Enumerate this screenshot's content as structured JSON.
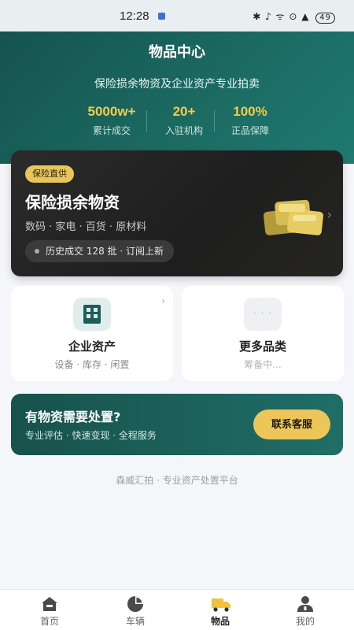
{
  "status_bar": {
    "time": "12:28",
    "indicators": "✱ ♪ ᯤ ⊙ ▲",
    "battery": "49"
  },
  "hero": {
    "title": "物品中心",
    "subtitle": "保险损余物资及企业资产专业拍卖",
    "stats": [
      {
        "value": "5000w+",
        "label": "累计成交"
      },
      {
        "value": "20+",
        "label": "入驻机构"
      },
      {
        "value": "100%",
        "label": "正品保障"
      }
    ],
    "accent_color": "#f2cc4d"
  },
  "insurance_card": {
    "badge": "保险直供",
    "title": "保险损余物资",
    "categories": "数码 · 家电 · 百货 · 原材料",
    "pill_text": "历史成交 128 批 · 订阅上新",
    "icon": "gold-bars-icon",
    "chevron": "›"
  },
  "tiles": [
    {
      "title": "企业资产",
      "subtitle": "设备 · 库存 · 闲置",
      "icon": "building-icon",
      "chevron": "›"
    },
    {
      "title": "更多品类",
      "subtitle": "筹备中...",
      "icon": "more-dots-icon",
      "icon_text": "· · ·"
    }
  ],
  "cta": {
    "title": "有物资需要处置?",
    "subtitle": "专业评估 · 快速变现 · 全程服务",
    "button_label": "联系客服"
  },
  "footer_note": "森威汇拍 · 专业资产处置平台",
  "tabbar": {
    "items": [
      {
        "label": "首页",
        "icon": "home-icon"
      },
      {
        "label": "车辆",
        "icon": "pie-chart-icon"
      },
      {
        "label": "物品",
        "icon": "truck-icon",
        "active": true
      },
      {
        "label": "我的",
        "icon": "user-icon"
      }
    ],
    "active_color": "#f0c23a"
  }
}
